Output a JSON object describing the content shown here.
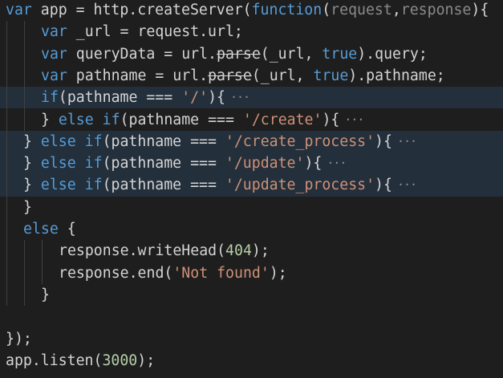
{
  "editor": {
    "lines": [
      {
        "indent": 0,
        "highlight": false,
        "folded": false,
        "tokens": [
          {
            "t": "var",
            "c": "kw"
          },
          {
            "t": " app = http.createServer(",
            "c": "plain"
          },
          {
            "t": "function",
            "c": "kw"
          },
          {
            "t": "(",
            "c": "plain"
          },
          {
            "t": "request",
            "c": "param"
          },
          {
            "t": ",",
            "c": "plain"
          },
          {
            "t": "response",
            "c": "param"
          },
          {
            "t": "){",
            "c": "plain"
          }
        ]
      },
      {
        "indent": 2,
        "highlight": false,
        "folded": false,
        "tokens": [
          {
            "t": "var",
            "c": "kw"
          },
          {
            "t": " _url = request.url;",
            "c": "plain"
          }
        ]
      },
      {
        "indent": 2,
        "highlight": false,
        "folded": false,
        "tokens": [
          {
            "t": "var",
            "c": "kw"
          },
          {
            "t": " queryData = url.",
            "c": "plain"
          },
          {
            "t": "parse",
            "c": "plain strike"
          },
          {
            "t": "(_url, ",
            "c": "plain"
          },
          {
            "t": "true",
            "c": "kw"
          },
          {
            "t": ").query;",
            "c": "plain"
          }
        ]
      },
      {
        "indent": 2,
        "highlight": false,
        "folded": false,
        "tokens": [
          {
            "t": "var",
            "c": "kw"
          },
          {
            "t": " pathname = url.",
            "c": "plain"
          },
          {
            "t": "parse",
            "c": "plain strike"
          },
          {
            "t": "(_url, ",
            "c": "plain"
          },
          {
            "t": "true",
            "c": "kw"
          },
          {
            "t": ").pathname;",
            "c": "plain"
          }
        ]
      },
      {
        "indent": 2,
        "highlight": true,
        "folded": true,
        "tokens": [
          {
            "t": "if",
            "c": "kw"
          },
          {
            "t": "(pathname === ",
            "c": "plain"
          },
          {
            "t": "'/'",
            "c": "str"
          },
          {
            "t": "){",
            "c": "plain"
          }
        ]
      },
      {
        "indent": 2,
        "highlight": false,
        "folded": true,
        "tokens": [
          {
            "t": "} ",
            "c": "plain"
          },
          {
            "t": "else",
            "c": "kw"
          },
          {
            "t": " ",
            "c": "plain"
          },
          {
            "t": "if",
            "c": "kw"
          },
          {
            "t": "(pathname === ",
            "c": "plain"
          },
          {
            "t": "'/create'",
            "c": "str"
          },
          {
            "t": "){",
            "c": "plain"
          }
        ]
      },
      {
        "indent": 1,
        "highlight": true,
        "folded": true,
        "tokens": [
          {
            "t": "} ",
            "c": "plain"
          },
          {
            "t": "else",
            "c": "kw"
          },
          {
            "t": " ",
            "c": "plain"
          },
          {
            "t": "if",
            "c": "kw"
          },
          {
            "t": "(pathname === ",
            "c": "plain"
          },
          {
            "t": "'/create_process'",
            "c": "str"
          },
          {
            "t": "){",
            "c": "plain"
          }
        ]
      },
      {
        "indent": 1,
        "highlight": true,
        "folded": true,
        "tokens": [
          {
            "t": "} ",
            "c": "plain"
          },
          {
            "t": "else",
            "c": "kw"
          },
          {
            "t": " ",
            "c": "plain"
          },
          {
            "t": "if",
            "c": "kw"
          },
          {
            "t": "(pathname === ",
            "c": "plain"
          },
          {
            "t": "'/update'",
            "c": "str"
          },
          {
            "t": "){",
            "c": "plain"
          }
        ]
      },
      {
        "indent": 1,
        "highlight": true,
        "folded": true,
        "tokens": [
          {
            "t": "} ",
            "c": "plain"
          },
          {
            "t": "else",
            "c": "kw"
          },
          {
            "t": " ",
            "c": "plain"
          },
          {
            "t": "if",
            "c": "kw"
          },
          {
            "t": "(pathname === ",
            "c": "plain"
          },
          {
            "t": "'/update_process'",
            "c": "str"
          },
          {
            "t": "){",
            "c": "plain"
          }
        ]
      },
      {
        "indent": 1,
        "highlight": false,
        "folded": false,
        "tokens": [
          {
            "t": "}",
            "c": "plain"
          }
        ]
      },
      {
        "indent": 1,
        "highlight": false,
        "folded": false,
        "tokens": [
          {
            "t": "else",
            "c": "kw"
          },
          {
            "t": " {",
            "c": "plain"
          }
        ]
      },
      {
        "indent": 3,
        "highlight": false,
        "folded": false,
        "tokens": [
          {
            "t": "response.writeHead(",
            "c": "plain"
          },
          {
            "t": "404",
            "c": "num"
          },
          {
            "t": ");",
            "c": "plain"
          }
        ]
      },
      {
        "indent": 3,
        "highlight": false,
        "folded": false,
        "tokens": [
          {
            "t": "response.end(",
            "c": "plain"
          },
          {
            "t": "'Not found'",
            "c": "str"
          },
          {
            "t": ");",
            "c": "plain"
          }
        ]
      },
      {
        "indent": 2,
        "highlight": false,
        "folded": false,
        "tokens": [
          {
            "t": "}",
            "c": "plain"
          }
        ]
      },
      {
        "indent": 0,
        "highlight": false,
        "folded": false,
        "tokens": []
      },
      {
        "indent": 0,
        "highlight": false,
        "folded": false,
        "tokens": [
          {
            "t": "});",
            "c": "plain"
          }
        ]
      },
      {
        "indent": 0,
        "highlight": false,
        "folded": false,
        "tokens": [
          {
            "t": "app.listen(",
            "c": "plain"
          },
          {
            "t": "3000",
            "c": "num"
          },
          {
            "t": ");",
            "c": "plain"
          }
        ]
      }
    ],
    "fold_marker": "···",
    "fold_icon": "ellipsis-icon",
    "colors": {
      "background": "#1e1e1e",
      "highlight": "#232f3b",
      "keyword": "#569cd6",
      "plain": "#d4d4d4",
      "parameter": "#8a8a8a",
      "string": "#ce9178",
      "number": "#b5cea8",
      "indent_guide": "#404040"
    }
  }
}
